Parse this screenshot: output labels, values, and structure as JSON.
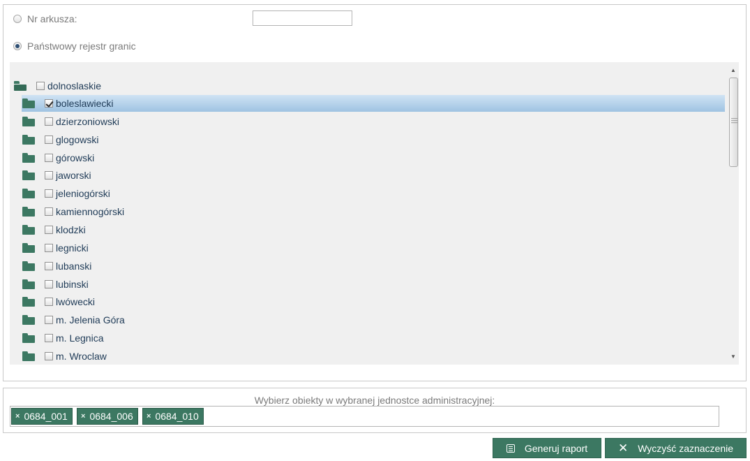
{
  "options": {
    "sheet_label": "Nr arkusza:",
    "sheet_value": "",
    "registry_label": "Państwowy rejestr granic"
  },
  "tree": {
    "root": {
      "label": "dolnoslaskie",
      "checked": false
    },
    "children": [
      {
        "label": "boleslawiecki",
        "checked": true,
        "selected": true
      },
      {
        "label": "dzierzoniowski",
        "checked": false
      },
      {
        "label": "glogowski",
        "checked": false
      },
      {
        "label": "górowski",
        "checked": false
      },
      {
        "label": "jaworski",
        "checked": false
      },
      {
        "label": "jeleniogórski",
        "checked": false
      },
      {
        "label": "kamiennogórski",
        "checked": false
      },
      {
        "label": "klodzki",
        "checked": false
      },
      {
        "label": "legnicki",
        "checked": false
      },
      {
        "label": "lubanski",
        "checked": false
      },
      {
        "label": "lubinski",
        "checked": false
      },
      {
        "label": "lwówecki",
        "checked": false
      },
      {
        "label": "m. Jelenia Góra",
        "checked": false
      },
      {
        "label": "m. Legnica",
        "checked": false
      },
      {
        "label": "m. Wroclaw",
        "checked": false
      }
    ]
  },
  "selection": {
    "label": "Wybierz obiekty w wybranej jednostce administracyjnej:",
    "tags": [
      "0684_001",
      "0684_006",
      "0684_010"
    ],
    "remove_glyph": "×"
  },
  "buttons": {
    "generate": "Generuj raport",
    "clear": "Wyczyść zaznaczenie"
  },
  "colors": {
    "accent_green": "#3c7862",
    "selected_row": "#9fc3e2",
    "text_blue": "#1f3b57"
  }
}
